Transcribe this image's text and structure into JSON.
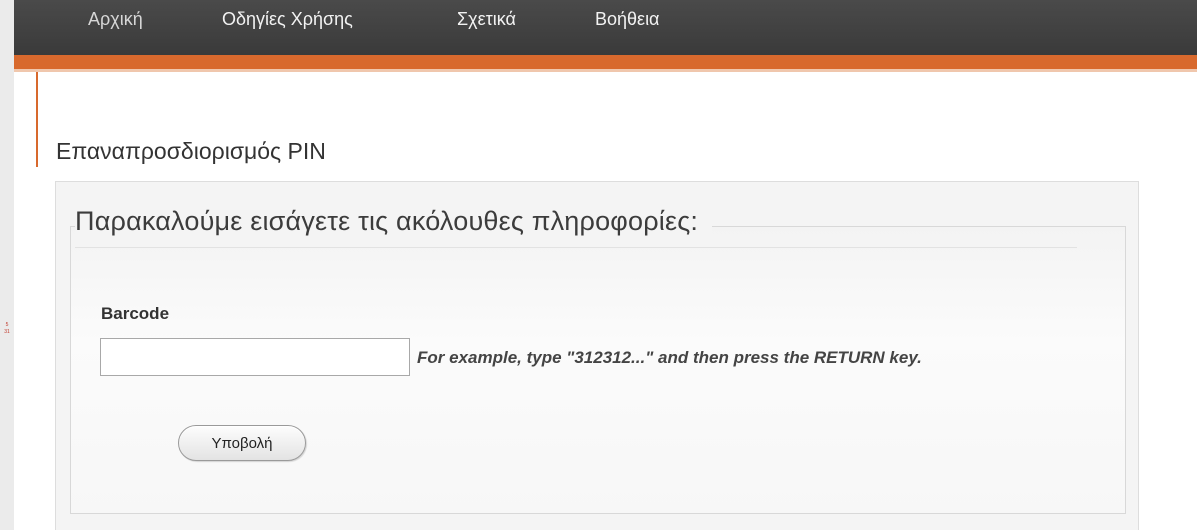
{
  "nav": {
    "items": [
      {
        "label": "Αρχική"
      },
      {
        "label": "Οδηγίες Χρήσης"
      },
      {
        "label": "Σχετικά"
      },
      {
        "label": "Βοήθεια"
      }
    ]
  },
  "side_marker": {
    "line1": "5",
    "line2": "31"
  },
  "page": {
    "title": "Επαναπροσδιορισμός PIN"
  },
  "form": {
    "legend": "Παρακαλούμε εισάγετε τις ακόλουθες πληροφορίες:",
    "barcode_label": "Barcode",
    "barcode_value": "",
    "hint": "For example, type \"312312...\" and then press the RETURN key.",
    "submit_label": "Υποβολή"
  },
  "colors": {
    "nav_background": "#3f3f3f",
    "accent": "#d8692d",
    "panel_background": "#f4f4f4"
  }
}
